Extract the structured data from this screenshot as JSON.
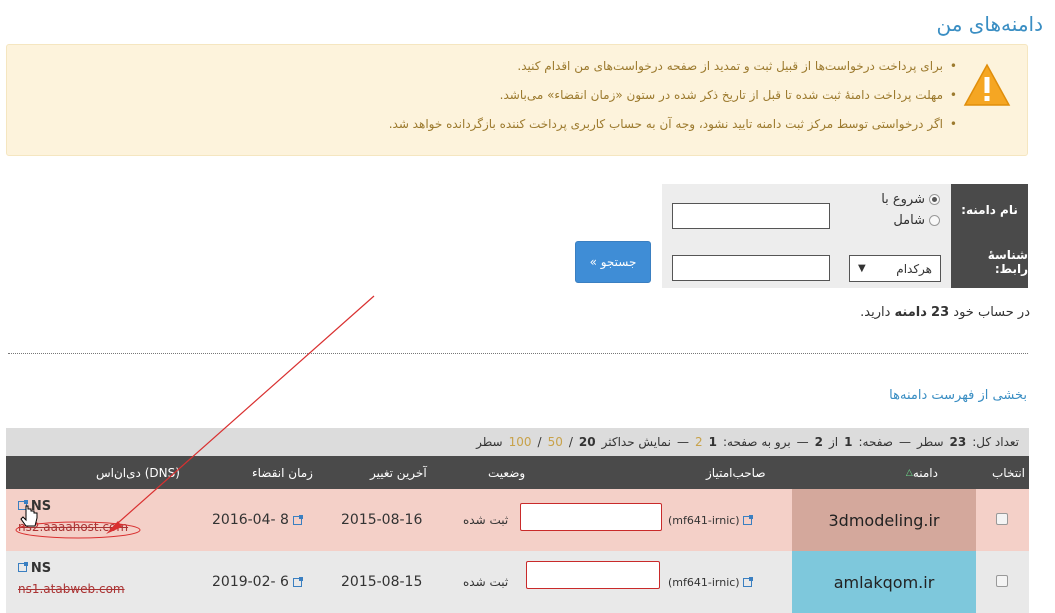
{
  "page": {
    "title": "دامنه‌های من"
  },
  "notice": {
    "items": [
      "برای پرداخت درخواست‌ها از قبیل ثبت و تمدید از صفحه درخواست‌های من اقدام کنید.",
      "مهلت پرداخت دامنهٔ ثبت شده تا قبل از تاریخ ذکر شده در ستون «زمان انقضاء» می‌باشد.",
      "اگر درخواستی توسط مرکز ثبت دامنه تایید نشود، وجه آن به حساب کاربری پرداخت کننده بازگردانده خواهد شد."
    ],
    "icon": "warning-icon",
    "color": "#9c7a2e"
  },
  "filter": {
    "domain_label": "نام دامنه:",
    "radio_starts": "شروع با",
    "radio_contains": "شامل",
    "contact_label": "شناسهٔ رابط:",
    "select_value": "هرکدام",
    "search_button": "جستجو »"
  },
  "summary": {
    "prefix": "در حساب خود",
    "count": "23",
    "noun": "دامنه",
    "suffix": "دارید."
  },
  "section": {
    "title": "بخشی از فهرست دامنه‌ها"
  },
  "pager": {
    "total_label": "تعداد کل:",
    "total": "23",
    "rows_word": "سطر",
    "page_label": "صفحه:",
    "page_current": "1",
    "of_word": "از",
    "page_total": "2",
    "goto_label": "برو به صفحه:",
    "goto_current": "1",
    "goto_other": "2",
    "max_label": "نمایش حداکثر",
    "max_current": "20",
    "max_opt1": "50",
    "max_opt2": "100",
    "sep": "—",
    "slash": "/"
  },
  "table": {
    "headers": {
      "select": "انتخاب",
      "domain": "دامنه",
      "owner": "صاحب‌امتیاز",
      "status": "وضعیت",
      "modified": "آخرین تغییر",
      "expiry": "زمان انقضاء",
      "dns": "دی‌ان‌اس (DNS)"
    },
    "rows": [
      {
        "domain": "3dmodeling.ir",
        "owner": "(mf641-irnic)",
        "status": "ثبت شده",
        "modified": "2015-08-16",
        "expiry": "2016-04- 8",
        "ns": "NS",
        "ns_host": "ns2.aaaahost.com"
      },
      {
        "domain": "amlakqom.ir",
        "owner": "(mf641-irnic)",
        "status": "ثبت شده",
        "modified": "2015-08-15",
        "expiry": "2019-02- 6",
        "ns": "NS",
        "ns_host": "ns1.atabweb.com"
      }
    ]
  },
  "colors": {
    "accent": "#3a8ec3",
    "button": "#3f8dd6",
    "header_bg": "#4a4a4a",
    "row_highlight": "#f4d0c8",
    "annotation": "#d93030"
  }
}
